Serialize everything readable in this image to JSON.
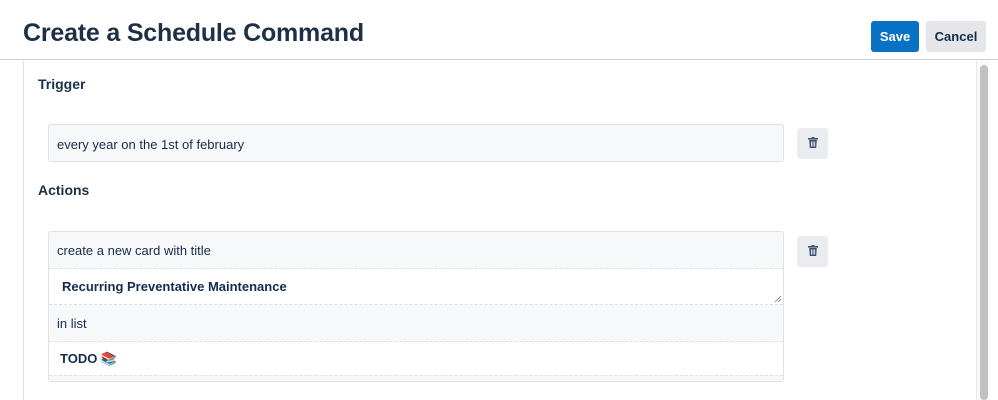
{
  "header": {
    "title": "Create a Schedule Command",
    "save_label": "Save",
    "cancel_label": "Cancel"
  },
  "trigger": {
    "heading": "Trigger",
    "value": "every year on the 1st of february"
  },
  "actions": {
    "heading": "Actions",
    "create_label": "create a new card with title",
    "card_title": "Recurring Preventative Maintenance",
    "in_list_label": "in list",
    "list_name": "TODO 📚"
  },
  "icons": {
    "trash": "trash-icon"
  },
  "colors": {
    "primary": "#0a72c4",
    "title": "#1d3045",
    "field_bg": "#f7f8f9",
    "border": "#dfe1e6"
  }
}
